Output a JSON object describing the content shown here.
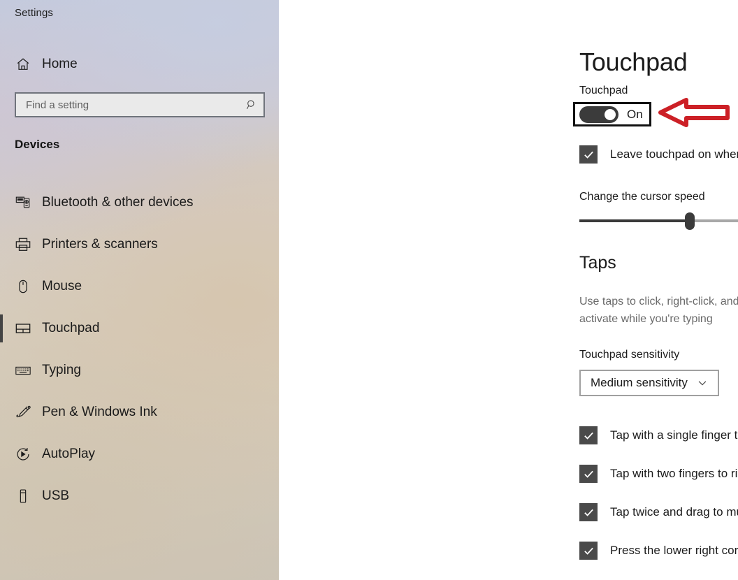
{
  "sidebar": {
    "app_title": "Settings",
    "home": {
      "label": "Home",
      "icon": "home-icon"
    },
    "search": {
      "placeholder": "Find a setting",
      "value": "",
      "icon": "search-icon"
    },
    "group_header": "Devices",
    "items": [
      {
        "label": "Bluetooth & other devices",
        "icon": "bluetooth-devices-icon",
        "selected": false
      },
      {
        "label": "Printers & scanners",
        "icon": "printer-icon",
        "selected": false
      },
      {
        "label": "Mouse",
        "icon": "mouse-icon",
        "selected": false
      },
      {
        "label": "Touchpad",
        "icon": "touchpad-icon",
        "selected": true
      },
      {
        "label": "Typing",
        "icon": "keyboard-icon",
        "selected": false
      },
      {
        "label": "Pen & Windows Ink",
        "icon": "pen-icon",
        "selected": false
      },
      {
        "label": "AutoPlay",
        "icon": "autoplay-icon",
        "selected": false
      },
      {
        "label": "USB",
        "icon": "usb-icon",
        "selected": false
      }
    ]
  },
  "main": {
    "page_title": "Touchpad",
    "touchpad_toggle": {
      "caption": "Touchpad",
      "state_label": "On",
      "checked": true,
      "highlighted": true
    },
    "leave_on_checkbox": {
      "label": "Leave touchpad on when a mouse is connected",
      "checked": true
    },
    "cursor_speed": {
      "label": "Change the cursor speed",
      "value_percent": 45,
      "min": 0,
      "max": 100
    },
    "taps": {
      "heading": "Taps",
      "description": "Use taps to click, right-click, and select. Turn down the sensitivity if they activate while you're typing",
      "sensitivity": {
        "label": "Touchpad sensitivity",
        "selected": "Medium sensitivity",
        "chevron": "chevron-down-icon"
      },
      "checkboxes": [
        {
          "label": "Tap with a single finger to single-click",
          "checked": true
        },
        {
          "label": "Tap with two fingers to right-click",
          "checked": true
        },
        {
          "label": "Tap twice and drag to multi-select",
          "checked": true
        },
        {
          "label": "Press the lower right corner of the touchpad to right-click",
          "checked": true
        }
      ]
    }
  },
  "annotation": {
    "arrow": {
      "icon": "arrow-left-annotation",
      "color": "#cc2026",
      "direction": "left"
    },
    "highlight_box_color": "#111111"
  },
  "colors": {
    "accent_selection_bar": "#444444",
    "checkbox_fill": "#4a4a4a",
    "toggle_on_fill": "#3b3b3b",
    "annotation_red": "#cc2026",
    "main_background": "#ffffff"
  }
}
